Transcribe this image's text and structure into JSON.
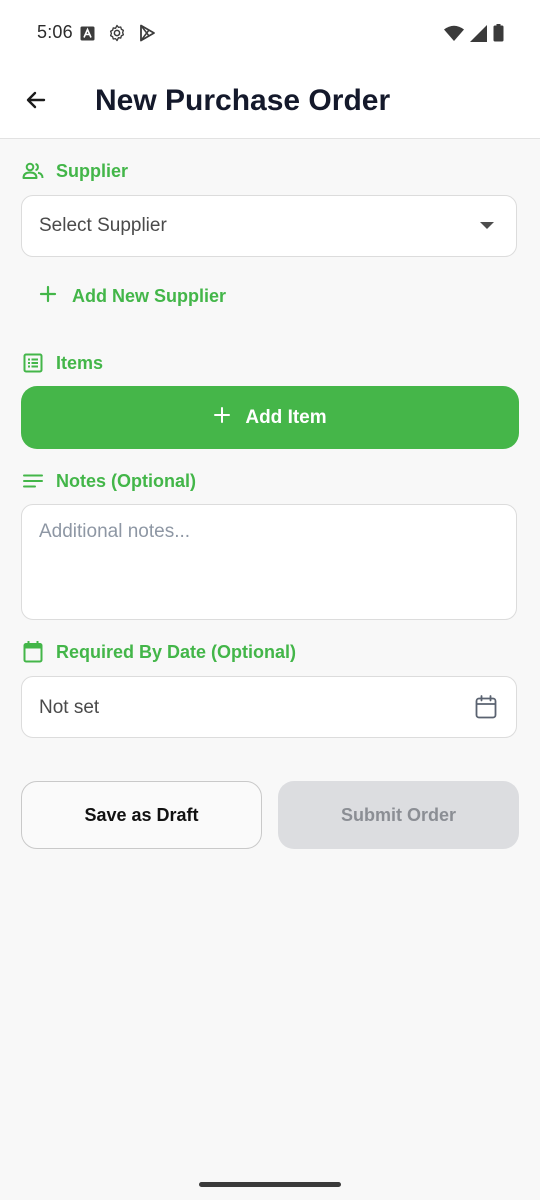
{
  "status_bar": {
    "time": "5:06",
    "left_icons": [
      "font-a-icon",
      "settings-gear-icon",
      "play-store-icon"
    ],
    "right_icons": [
      "wifi-icon",
      "cell-signal-icon",
      "battery-icon"
    ]
  },
  "app_bar": {
    "title": "New Purchase Order"
  },
  "supplier": {
    "label": "Supplier",
    "select_value": "Select Supplier",
    "add_new_label": "Add New Supplier"
  },
  "items": {
    "label": "Items",
    "add_item_label": "Add Item"
  },
  "notes": {
    "label": "Notes (Optional)",
    "placeholder": "Additional notes...",
    "value": ""
  },
  "required_date": {
    "label": "Required By Date (Optional)",
    "value": "Not set"
  },
  "actions": {
    "save_draft_label": "Save as Draft",
    "submit_label": "Submit Order"
  },
  "colors": {
    "accent": "#43b649",
    "primary_button": "#45b649",
    "disabled_button": "#dcdde0",
    "title_text": "#14192b"
  }
}
